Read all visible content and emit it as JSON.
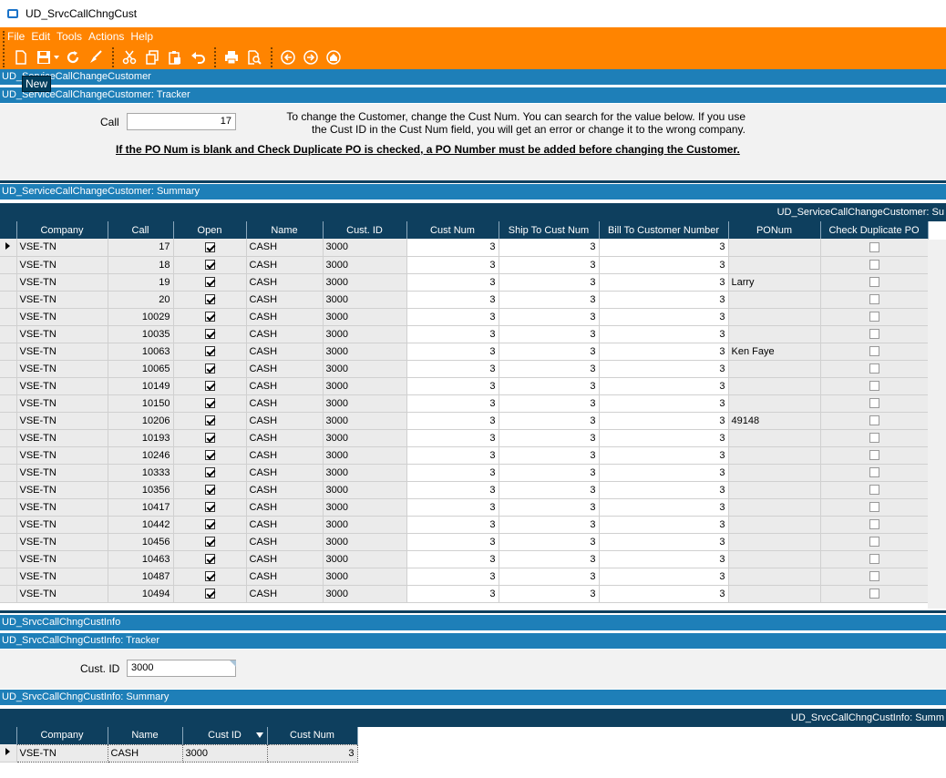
{
  "window": {
    "title": "UD_SrvcCallChngCust"
  },
  "menu": [
    "File",
    "Edit",
    "Tools",
    "Actions",
    "Help"
  ],
  "toolbar": {
    "icons": [
      "new-icon",
      "save-icon",
      "refresh-icon",
      "clear-icon",
      "cut-icon",
      "copy-icon",
      "paste-icon",
      "undo-icon",
      "print-icon",
      "print-preview-icon",
      "back-icon",
      "forward-icon",
      "home-icon"
    ],
    "tooltip": "New"
  },
  "section1": {
    "header": "UD_ServiceCallChangeCustomer",
    "tracker_header": "UD_ServiceCallChangeCustomer: Tracker",
    "call_label": "Call",
    "call_value": "17",
    "info_line1": "To change the Customer, change the Cust Num.  You can search for the value below.  If you use",
    "info_line2": "the Cust ID in the Cust Num field, you will get an error or change it to the wrong company.",
    "warning": "If the PO Num is blank and Check Duplicate PO is checked, a PO Number must be added before changing the Customer.",
    "summary_header": "UD_ServiceCallChangeCustomer: Summary",
    "grid_caption": "UD_ServiceCallChangeCustomer: Su"
  },
  "grid1": {
    "columns": [
      "Company",
      "Call",
      "Open",
      "Name",
      "Cust. ID",
      "Cust Num",
      "Ship To Cust Num",
      "Bill To Customer Number",
      "PONum",
      "Check Duplicate PO"
    ],
    "rows": [
      {
        "company": "VSE-TN",
        "call": "17",
        "open": true,
        "name": "CASH",
        "custid": "3000",
        "custnum": "3",
        "shipto": "3",
        "billto": "3",
        "ponum": "",
        "dup": false
      },
      {
        "company": "VSE-TN",
        "call": "18",
        "open": true,
        "name": "CASH",
        "custid": "3000",
        "custnum": "3",
        "shipto": "3",
        "billto": "3",
        "ponum": "",
        "dup": false
      },
      {
        "company": "VSE-TN",
        "call": "19",
        "open": true,
        "name": "CASH",
        "custid": "3000",
        "custnum": "3",
        "shipto": "3",
        "billto": "3",
        "ponum": "Larry",
        "dup": false
      },
      {
        "company": "VSE-TN",
        "call": "20",
        "open": true,
        "name": "CASH",
        "custid": "3000",
        "custnum": "3",
        "shipto": "3",
        "billto": "3",
        "ponum": "",
        "dup": false
      },
      {
        "company": "VSE-TN",
        "call": "10029",
        "open": true,
        "name": "CASH",
        "custid": "3000",
        "custnum": "3",
        "shipto": "3",
        "billto": "3",
        "ponum": "",
        "dup": false
      },
      {
        "company": "VSE-TN",
        "call": "10035",
        "open": true,
        "name": "CASH",
        "custid": "3000",
        "custnum": "3",
        "shipto": "3",
        "billto": "3",
        "ponum": "",
        "dup": false
      },
      {
        "company": "VSE-TN",
        "call": "10063",
        "open": true,
        "name": "CASH",
        "custid": "3000",
        "custnum": "3",
        "shipto": "3",
        "billto": "3",
        "ponum": "Ken Faye",
        "dup": false
      },
      {
        "company": "VSE-TN",
        "call": "10065",
        "open": true,
        "name": "CASH",
        "custid": "3000",
        "custnum": "3",
        "shipto": "3",
        "billto": "3",
        "ponum": "",
        "dup": false
      },
      {
        "company": "VSE-TN",
        "call": "10149",
        "open": true,
        "name": "CASH",
        "custid": "3000",
        "custnum": "3",
        "shipto": "3",
        "billto": "3",
        "ponum": "",
        "dup": false
      },
      {
        "company": "VSE-TN",
        "call": "10150",
        "open": true,
        "name": "CASH",
        "custid": "3000",
        "custnum": "3",
        "shipto": "3",
        "billto": "3",
        "ponum": "",
        "dup": false
      },
      {
        "company": "VSE-TN",
        "call": "10206",
        "open": true,
        "name": "CASH",
        "custid": "3000",
        "custnum": "3",
        "shipto": "3",
        "billto": "3",
        "ponum": "49148",
        "dup": false
      },
      {
        "company": "VSE-TN",
        "call": "10193",
        "open": true,
        "name": "CASH",
        "custid": "3000",
        "custnum": "3",
        "shipto": "3",
        "billto": "3",
        "ponum": "",
        "dup": false
      },
      {
        "company": "VSE-TN",
        "call": "10246",
        "open": true,
        "name": "CASH",
        "custid": "3000",
        "custnum": "3",
        "shipto": "3",
        "billto": "3",
        "ponum": "",
        "dup": false
      },
      {
        "company": "VSE-TN",
        "call": "10333",
        "open": true,
        "name": "CASH",
        "custid": "3000",
        "custnum": "3",
        "shipto": "3",
        "billto": "3",
        "ponum": "",
        "dup": false
      },
      {
        "company": "VSE-TN",
        "call": "10356",
        "open": true,
        "name": "CASH",
        "custid": "3000",
        "custnum": "3",
        "shipto": "3",
        "billto": "3",
        "ponum": "",
        "dup": false
      },
      {
        "company": "VSE-TN",
        "call": "10417",
        "open": true,
        "name": "CASH",
        "custid": "3000",
        "custnum": "3",
        "shipto": "3",
        "billto": "3",
        "ponum": "",
        "dup": false
      },
      {
        "company": "VSE-TN",
        "call": "10442",
        "open": true,
        "name": "CASH",
        "custid": "3000",
        "custnum": "3",
        "shipto": "3",
        "billto": "3",
        "ponum": "",
        "dup": false
      },
      {
        "company": "VSE-TN",
        "call": "10456",
        "open": true,
        "name": "CASH",
        "custid": "3000",
        "custnum": "3",
        "shipto": "3",
        "billto": "3",
        "ponum": "",
        "dup": false
      },
      {
        "company": "VSE-TN",
        "call": "10463",
        "open": true,
        "name": "CASH",
        "custid": "3000",
        "custnum": "3",
        "shipto": "3",
        "billto": "3",
        "ponum": "",
        "dup": false
      },
      {
        "company": "VSE-TN",
        "call": "10487",
        "open": true,
        "name": "CASH",
        "custid": "3000",
        "custnum": "3",
        "shipto": "3",
        "billto": "3",
        "ponum": "",
        "dup": false
      },
      {
        "company": "VSE-TN",
        "call": "10494",
        "open": true,
        "name": "CASH",
        "custid": "3000",
        "custnum": "3",
        "shipto": "3",
        "billto": "3",
        "ponum": "",
        "dup": false
      }
    ]
  },
  "section2": {
    "header": "UD_SrvcCallChngCustInfo",
    "tracker_header": "UD_SrvcCallChngCustInfo: Tracker",
    "custid_label": "Cust. ID",
    "custid_value": "3000",
    "summary_header": "UD_SrvcCallChngCustInfo: Summary",
    "grid_caption": "UD_SrvcCallChngCustInfo: Summ"
  },
  "grid2": {
    "columns": [
      "Company",
      "Name",
      "Cust ID",
      "Cust Num"
    ],
    "rows": [
      {
        "company": "VSE-TN",
        "name": "CASH",
        "custid": "3000",
        "custnum": "3"
      }
    ]
  },
  "colors": {
    "accent_orange": "#ff8400",
    "header_blue": "#1e7fb8",
    "grid_header_navy": "#0e3f5e"
  }
}
